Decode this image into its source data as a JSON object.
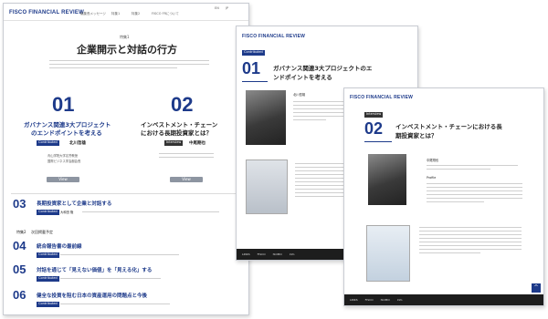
{
  "page1": {
    "logo": "FISCO FINANCIAL REVIEW",
    "lang": [
      "EN",
      "JP"
    ],
    "nav": [
      "編集長メッセージ",
      "特集1",
      "特集2",
      "FISCO FRについて"
    ],
    "feature_label": "特集1",
    "feature_title": "企業開示と対話の行方",
    "item01": {
      "num": "01",
      "title_line1": "ガバナンス関連3大プロジェクト",
      "title_line2": "のエンドポイントを考える",
      "tag": "Contributed",
      "person": "北川哲雄",
      "affil1": "青山学院大学名誉教授",
      "affil2": "国際ビジネス学会副会長",
      "button": "View"
    },
    "item02": {
      "num": "02",
      "title_line1": "インベストメント・チェーン",
      "title_line2": "における長期投資家とは？",
      "tag": "Interview",
      "person": "中尾剛也",
      "affil1": "",
      "affil2": "",
      "button": "View"
    },
    "item03": {
      "num": "03",
      "title": "長期投資家として企業と対話する",
      "tag": "Contributed",
      "person": "大和田 隆"
    },
    "feature2_label": "特集2",
    "feature2_sub": "次回掲載予定",
    "item04": {
      "num": "04",
      "title": "統合報告書の最前線",
      "tag": "Contributed",
      "person": ""
    },
    "item05": {
      "num": "05",
      "title": "対話を通じて「見えない価値」を「見える化」する",
      "tag": "Contributed",
      "person": ""
    },
    "item06": {
      "num": "06",
      "title": "健全な投資を阻む日本の資産運用の問題点と今後",
      "tag": "Contributed",
      "person": ""
    }
  },
  "page2": {
    "logo": "FISCO FINANCIAL REVIEW",
    "tag": "Contributed",
    "num": "01",
    "title_line1": "ガバナンス関連3大プロジェクトのエ",
    "title_line2": "ンドポイントを考える",
    "person": "北川哲雄",
    "footer": [
      "LINKS",
      "FISCO",
      "ISOMO",
      "Info"
    ]
  },
  "page3": {
    "logo": "FISCO FINANCIAL REVIEW",
    "tag": "Interview",
    "num": "02",
    "title_line1": "インベストメント・チェーンにおける長",
    "title_line2": "期投資家とは？",
    "person": "中尾剛也",
    "profile": "Profile",
    "footer": [
      "LINKS",
      "FISCO",
      "ISOMO",
      "Info"
    ],
    "scrolltop": "^"
  }
}
